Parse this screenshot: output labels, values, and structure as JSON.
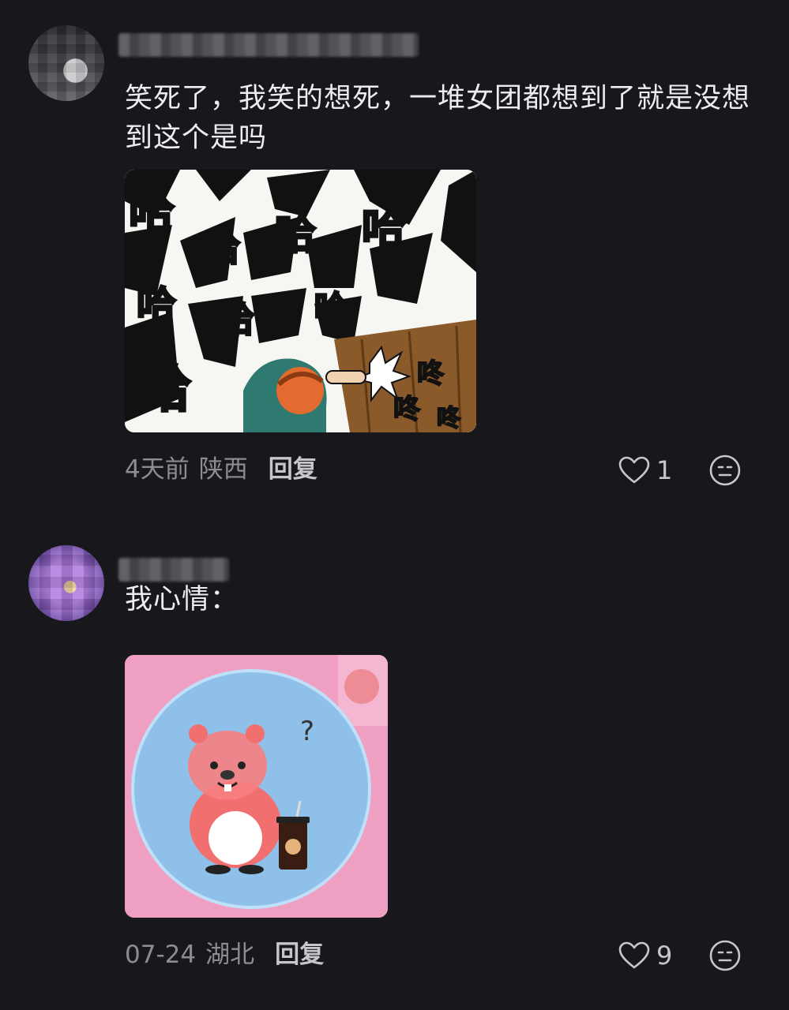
{
  "comments": [
    {
      "text": "笑死了，我笑的想死，一堆女团都想到了就是没想到这个是吗",
      "image_caption_chars": [
        "哈",
        "哈",
        "哈",
        "哈",
        "哈",
        "哈",
        "哈",
        "哈",
        "咚",
        "咚",
        "咚"
      ],
      "time": "4天前",
      "location": "陕西",
      "reply_label": "回复",
      "likes": "1"
    },
    {
      "text": "我心情：",
      "time": "07-24",
      "location": "湖北",
      "reply_label": "回复",
      "likes": "9"
    }
  ],
  "colors": {
    "background": "#17171c",
    "text": "#ececf1",
    "meta": "#8c8c94"
  },
  "icons": {
    "like": "heart-outline-icon",
    "emoji": "neutral-face-icon"
  }
}
